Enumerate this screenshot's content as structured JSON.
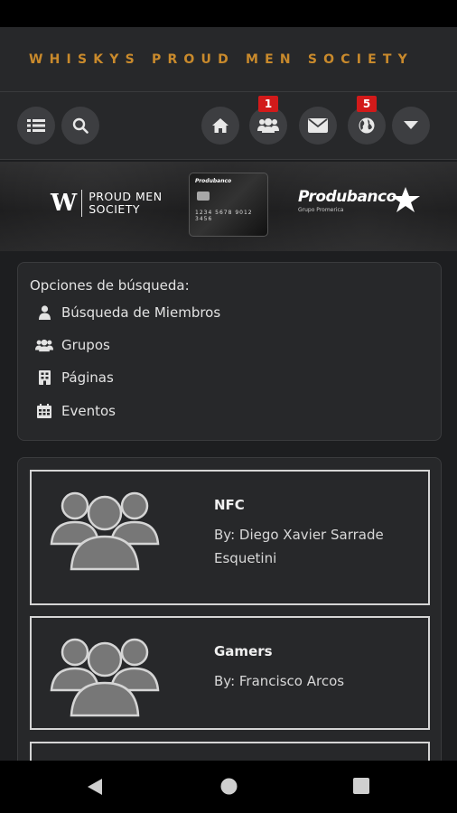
{
  "site": {
    "title": "WHISKYS PROUD MEN SOCIETY"
  },
  "toolbar": {
    "friend_requests_count": "1",
    "notifications_count": "5"
  },
  "banner": {
    "sponsor_left_line1": "PROUD MEN",
    "sponsor_left_line2": "SOCIETY",
    "card_brand": "Produbanco",
    "card_number": "1234 5678 9012 3456",
    "sponsor_right": "Produbanco",
    "sponsor_right_sub": "Grupo Promerica"
  },
  "search": {
    "title": "Opciones de búsqueda:",
    "options": [
      {
        "label": "Búsqueda de Miembros",
        "icon": "user-icon"
      },
      {
        "label": "Grupos",
        "icon": "users-icon"
      },
      {
        "label": "Páginas",
        "icon": "page-icon"
      },
      {
        "label": "Eventos",
        "icon": "calendar-icon"
      }
    ]
  },
  "groups": [
    {
      "name": "NFC",
      "by": "By: Diego Xavier Sarrade Esquetini"
    },
    {
      "name": "Gamers",
      "by": "By: Francisco Arcos"
    },
    {
      "name": "",
      "by": ""
    }
  ],
  "colors": {
    "accent": "#c98a2c",
    "background": "#1d1e20",
    "panel": "#27282a",
    "badge": "#d21a1a"
  }
}
